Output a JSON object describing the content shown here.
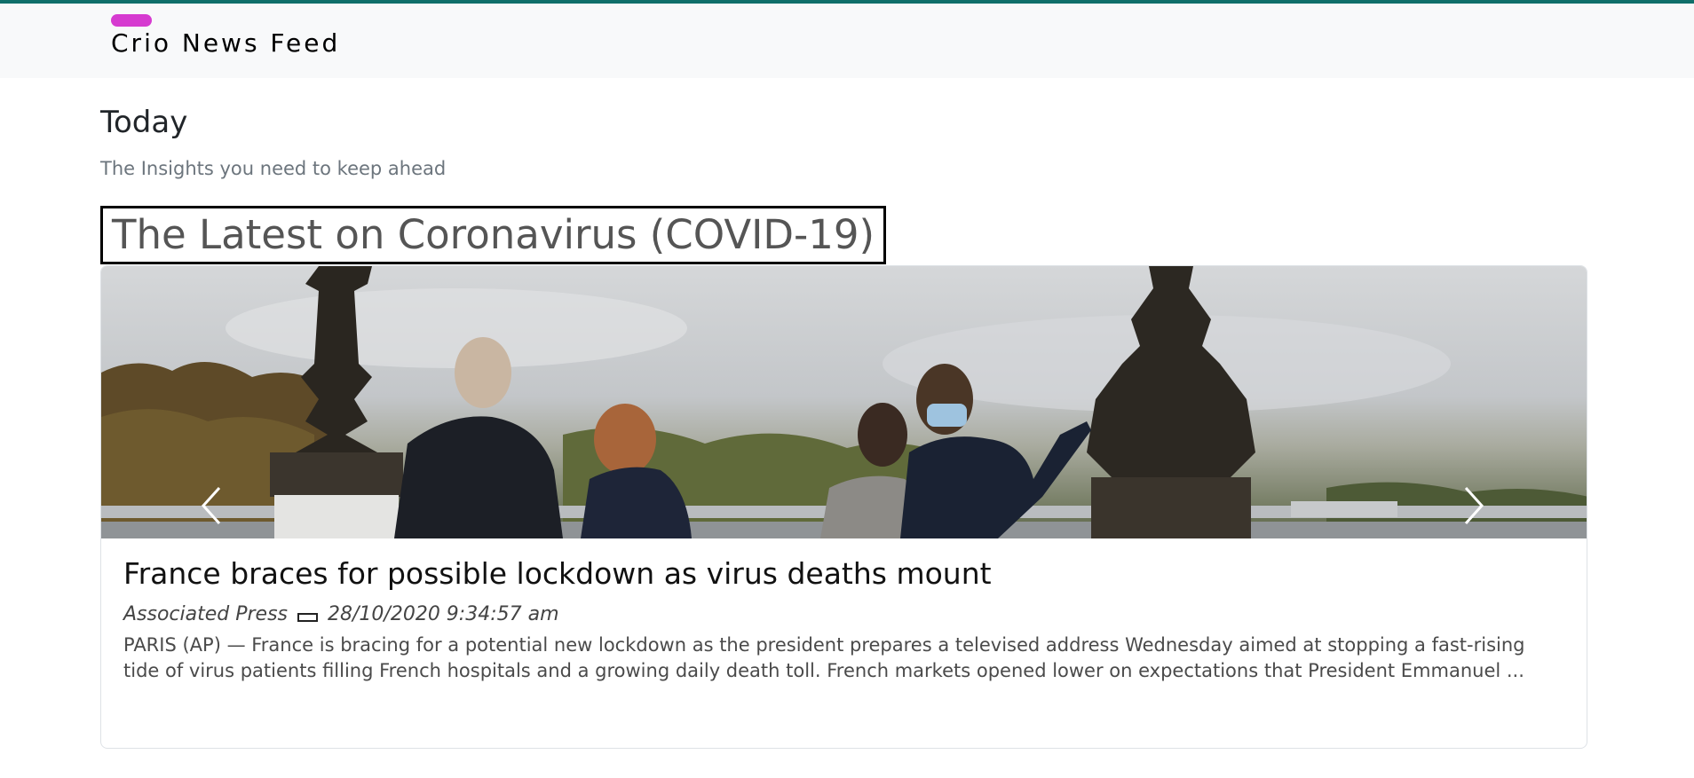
{
  "navbar": {
    "brand": "Crio News Feed"
  },
  "page": {
    "heading": "Today",
    "subheading": "The Insights you need to keep ahead"
  },
  "section": {
    "title": "The Latest on Coronavirus (COVID-19)"
  },
  "article": {
    "headline": "France braces for possible lockdown as virus deaths mount",
    "source": "Associated Press",
    "date": "28/10/2020 9:34:57 am",
    "description": "PARIS (AP) — France is bracing for a potential new lockdown as the president prepares a televised address Wednesday aimed at stopping a fast-rising tide of virus patients filling French hospitals and a growing daily death toll. French markets opened lower on expectations that President Emmanuel ..."
  },
  "carousel": {
    "prev_icon": "chevron-left-icon",
    "next_icon": "chevron-right-icon"
  },
  "colors": {
    "accent_bar": "#0f6f6a",
    "brand_pill": "#d63bd0",
    "navbar_bg": "#f8f9fa"
  }
}
